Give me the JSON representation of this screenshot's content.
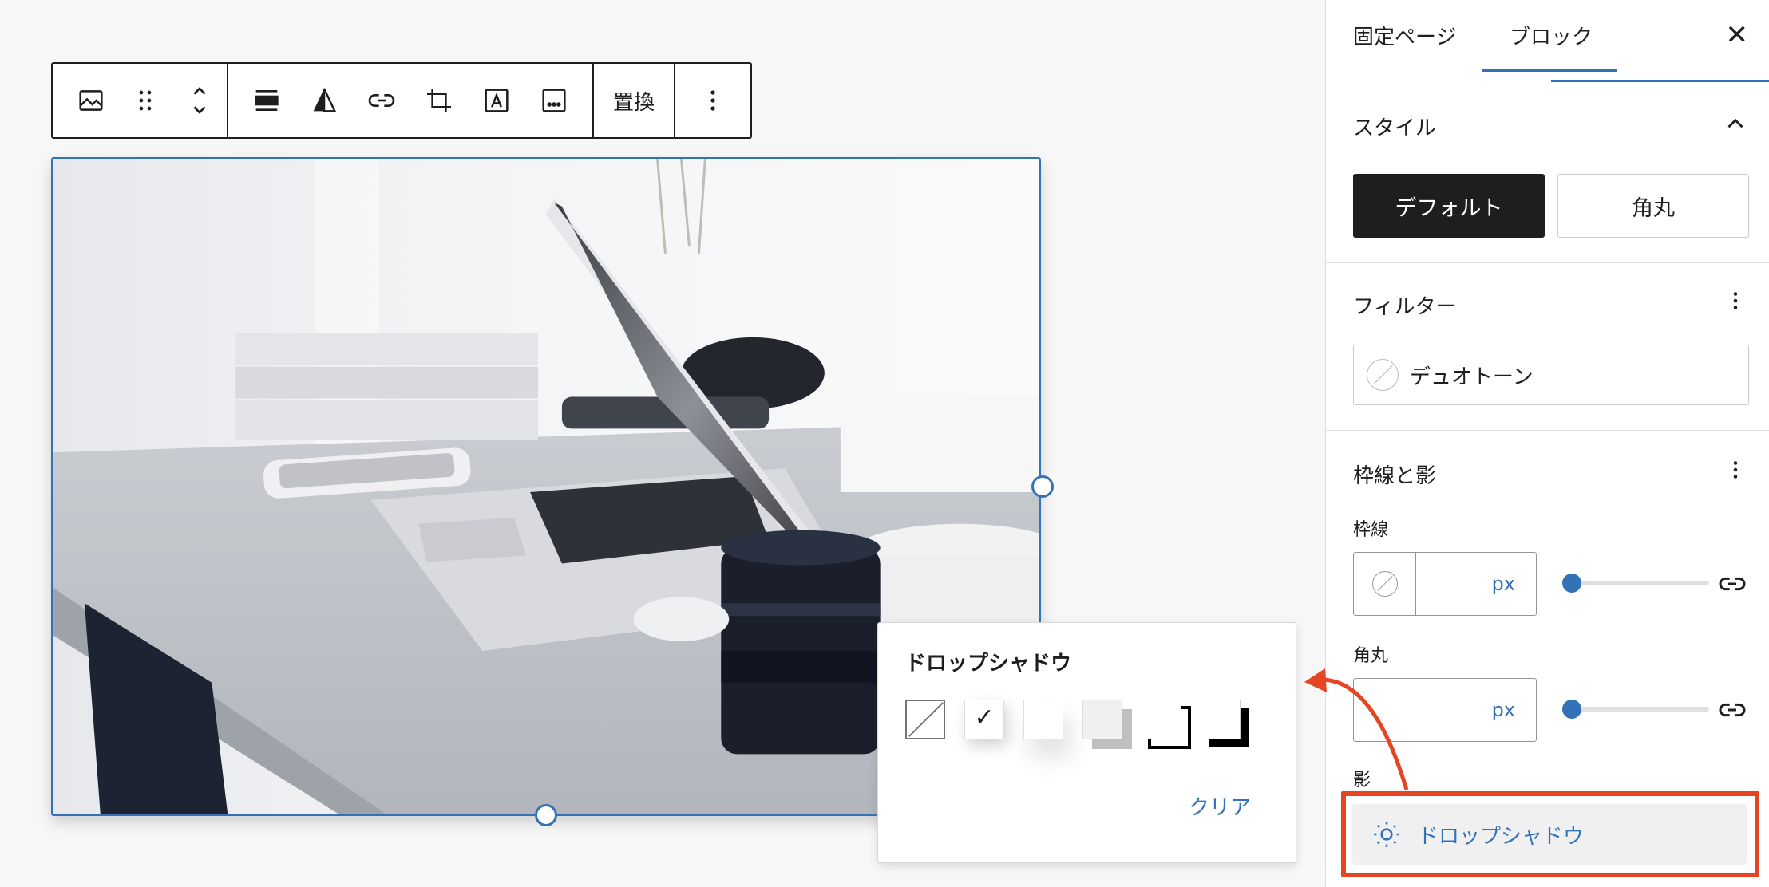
{
  "toolbar": {
    "replace_label": "置換"
  },
  "popover": {
    "title": "ドロップシャドウ",
    "clear_label": "クリア",
    "check_mark": "✓"
  },
  "sidebar": {
    "tabs": [
      {
        "label": "固定ページ"
      },
      {
        "label": "ブロック"
      }
    ],
    "close_label": "✕",
    "styles": {
      "title": "スタイル",
      "options": [
        {
          "label": "デフォルト"
        },
        {
          "label": "角丸"
        }
      ]
    },
    "filter": {
      "title": "フィルター",
      "duotone_label": "デュオトーン"
    },
    "border_shadow": {
      "title": "枠線と影",
      "border_label": "枠線",
      "border_unit": "px",
      "radius_label": "角丸",
      "radius_unit": "px",
      "shadow_label": "影",
      "shadow_button_label": "ドロップシャドウ"
    }
  },
  "colors": {
    "accent": "#3472b7",
    "highlight": "#e64524",
    "dark": "#1e1e1e"
  }
}
